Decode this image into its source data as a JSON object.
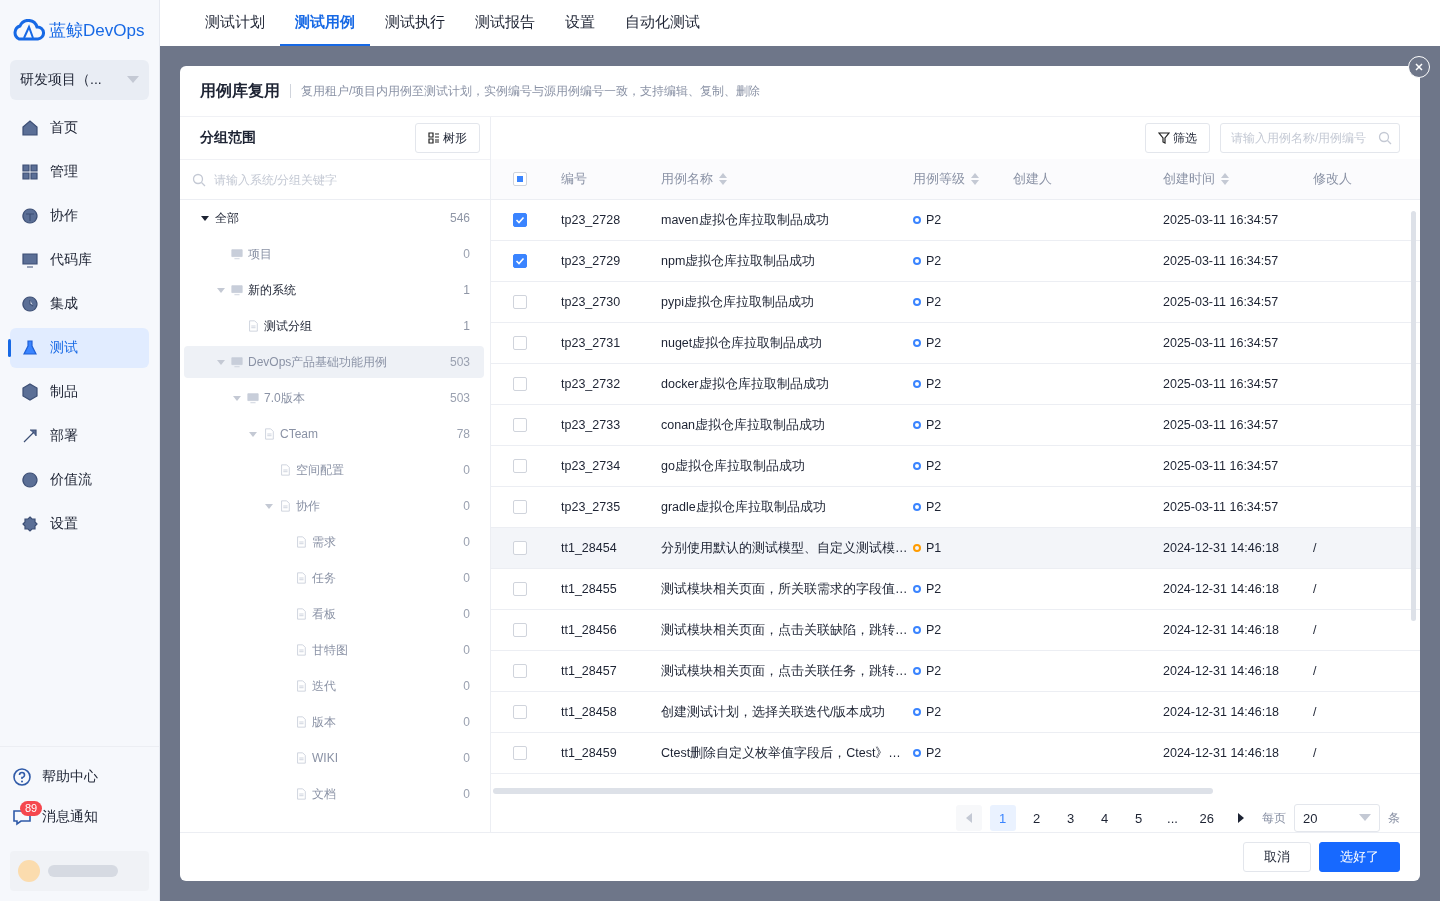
{
  "brand": {
    "name": "蓝鲸DevOps"
  },
  "project_select": {
    "value": "研发项目（..."
  },
  "top_tabs": [
    {
      "label": "测试计划",
      "selected": false
    },
    {
      "label": "测试用例",
      "selected": true
    },
    {
      "label": "测试执行",
      "selected": false
    },
    {
      "label": "测试报告",
      "selected": false
    },
    {
      "label": "设置",
      "selected": false
    },
    {
      "label": "自动化测试",
      "selected": false
    }
  ],
  "nav": [
    {
      "label": "首页",
      "selected": false
    },
    {
      "label": "管理",
      "selected": false
    },
    {
      "label": "协作",
      "selected": false
    },
    {
      "label": "代码库",
      "selected": false
    },
    {
      "label": "集成",
      "selected": false
    },
    {
      "label": "测试",
      "selected": true
    },
    {
      "label": "制品",
      "selected": false
    },
    {
      "label": "部署",
      "selected": false
    },
    {
      "label": "价值流",
      "selected": false
    },
    {
      "label": "设置",
      "selected": false
    }
  ],
  "nav_bottom": [
    {
      "kind": "help",
      "label": "帮助中心"
    },
    {
      "kind": "message",
      "label": "消息通知",
      "badge": "89"
    }
  ],
  "dialog": {
    "title": "用例库复用",
    "subtitle": "复用租户/项目内用例至测试计划，实例编号与源用例编号一致，支持编辑、复制、删除",
    "group_panel": {
      "title": "分组范围",
      "view_button": "树形",
      "search": {
        "placeholder": "请输入系统/分组关键字"
      },
      "tree": [
        {
          "label": "全部",
          "count": "546",
          "expanded": true,
          "disabled": false,
          "selected": false,
          "children": [
            {
              "label": "项目",
              "count": "0",
              "kind": "system",
              "disabled": true,
              "selected": false
            },
            {
              "label": "新的系统",
              "count": "1",
              "kind": "system",
              "expanded": true,
              "disabled": false,
              "selected": false,
              "children": [
                {
                  "label": "测试分组",
                  "count": "1",
                  "kind": "group",
                  "disabled": false,
                  "selected": false
                }
              ]
            },
            {
              "label": "DevOps产品基础功能用例",
              "count": "503",
              "kind": "system",
              "expanded": true,
              "disabled": true,
              "selected": true,
              "children": [
                {
                  "label": "7.0版本",
                  "count": "503",
                  "kind": "system",
                  "expanded": true,
                  "disabled": true,
                  "selected": false,
                  "children": [
                    {
                      "label": "CTeam",
                      "count": "78",
                      "kind": "group",
                      "expanded": true,
                      "disabled": true,
                      "selected": false,
                      "children": [
                        {
                          "label": "空间配置",
                          "count": "0",
                          "kind": "group",
                          "disabled": true,
                          "selected": false
                        },
                        {
                          "label": "协作",
                          "count": "0",
                          "kind": "group",
                          "expanded": true,
                          "disabled": true,
                          "selected": false,
                          "children": [
                            {
                              "label": "需求",
                              "count": "0",
                              "kind": "group",
                              "disabled": true,
                              "selected": false
                            },
                            {
                              "label": "任务",
                              "count": "0",
                              "kind": "group",
                              "disabled": true,
                              "selected": false
                            },
                            {
                              "label": "看板",
                              "count": "0",
                              "kind": "group",
                              "disabled": true,
                              "selected": false
                            },
                            {
                              "label": "甘特图",
                              "count": "0",
                              "kind": "group",
                              "disabled": true,
                              "selected": false
                            },
                            {
                              "label": "迭代",
                              "count": "0",
                              "kind": "group",
                              "disabled": true,
                              "selected": false
                            },
                            {
                              "label": "版本",
                              "count": "0",
                              "kind": "group",
                              "disabled": true,
                              "selected": false
                            },
                            {
                              "label": "WIKI",
                              "count": "0",
                              "kind": "group",
                              "disabled": true,
                              "selected": false
                            },
                            {
                              "label": "文档",
                              "count": "0",
                              "kind": "group",
                              "disabled": true,
                              "selected": false
                            }
                          ]
                        }
                      ]
                    }
                  ]
                }
              ]
            }
          ]
        }
      ]
    },
    "case_panel": {
      "filter_button": "筛选",
      "search": {
        "placeholder": "请输入用例名称/用例编号"
      },
      "header_checkbox": {
        "indeterminate": true
      },
      "columns": [
        {
          "label": "编号",
          "sortable": false
        },
        {
          "label": "用例名称",
          "sortable": true
        },
        {
          "label": "用例等级",
          "sortable": true
        },
        {
          "label": "创建人",
          "sortable": false
        },
        {
          "label": "创建时间",
          "sortable": true
        },
        {
          "label": "修改人",
          "sortable": false
        }
      ],
      "rows": [
        {
          "checked": true,
          "selected": false,
          "id": "tp23_2728",
          "name": "maven虚拟仓库拉取制品成功",
          "level": "P2",
          "color": "#3a84ff",
          "created": "2025-03-11 16:34:57"
        },
        {
          "checked": true,
          "selected": false,
          "id": "tp23_2729",
          "name": "npm虚拟仓库拉取制品成功",
          "level": "P2",
          "color": "#3a84ff",
          "created": "2025-03-11 16:34:57"
        },
        {
          "checked": false,
          "selected": false,
          "id": "tp23_2730",
          "name": "pypi虚拟仓库拉取制品成功",
          "level": "P2",
          "color": "#3a84ff",
          "created": "2025-03-11 16:34:57"
        },
        {
          "checked": false,
          "selected": false,
          "id": "tp23_2731",
          "name": "nuget虚拟仓库拉取制品成功",
          "level": "P2",
          "color": "#3a84ff",
          "created": "2025-03-11 16:34:57"
        },
        {
          "checked": false,
          "selected": false,
          "id": "tp23_2732",
          "name": "docker虚拟仓库拉取制品成功",
          "level": "P2",
          "color": "#3a84ff",
          "created": "2025-03-11 16:34:57"
        },
        {
          "checked": false,
          "selected": false,
          "id": "tp23_2733",
          "name": "conan虚拟仓库拉取制品成功",
          "level": "P2",
          "color": "#3a84ff",
          "created": "2025-03-11 16:34:57"
        },
        {
          "checked": false,
          "selected": false,
          "id": "tp23_2734",
          "name": "go虚拟仓库拉取制品成功",
          "level": "P2",
          "color": "#3a84ff",
          "created": "2025-03-11 16:34:57"
        },
        {
          "checked": false,
          "selected": false,
          "id": "tp23_2735",
          "name": "gradle虚拟仓库拉取制品成功",
          "level": "P2",
          "color": "#3a84ff",
          "created": "2025-03-11 16:34:57"
        },
        {
          "checked": false,
          "selected": true,
          "id": "tt1_28454",
          "name": "分别使用默认的测试模型、自定义测试模…",
          "level": "P1",
          "color": "#ff9c01",
          "created": "2024-12-31 14:46:18",
          "modifier": "/"
        },
        {
          "checked": false,
          "selected": false,
          "id": "tt1_28455",
          "name": "测试模块相关页面，所关联需求的字段值…",
          "level": "P2",
          "color": "#3a84ff",
          "created": "2024-12-31 14:46:18",
          "modifier": "/"
        },
        {
          "checked": false,
          "selected": false,
          "id": "tt1_28456",
          "name": "测试模块相关页面，点击关联缺陷，跳转…",
          "level": "P2",
          "color": "#3a84ff",
          "created": "2024-12-31 14:46:18",
          "modifier": "/"
        },
        {
          "checked": false,
          "selected": false,
          "id": "tt1_28457",
          "name": "测试模块相关页面，点击关联任务，跳转…",
          "level": "P2",
          "color": "#3a84ff",
          "created": "2024-12-31 14:46:18",
          "modifier": "/"
        },
        {
          "checked": false,
          "selected": false,
          "id": "tt1_28458",
          "name": "创建测试计划，选择关联迭代/版本成功",
          "level": "P2",
          "color": "#3a84ff",
          "created": "2024-12-31 14:46:18",
          "modifier": "/"
        },
        {
          "checked": false,
          "selected": false,
          "id": "tt1_28459",
          "name": "Ctest删除自定义枚举值字段后，Ctest》…",
          "level": "P2",
          "color": "#3a84ff",
          "created": "2024-12-31 14:46:18",
          "modifier": "/"
        }
      ],
      "pagination": {
        "prev_disabled": true,
        "pages": [
          {
            "label": "1",
            "selected": true
          },
          {
            "label": "2",
            "selected": false
          },
          {
            "label": "3",
            "selected": false
          },
          {
            "label": "4",
            "selected": false
          },
          {
            "label": "5",
            "selected": false
          },
          {
            "label": "...",
            "selected": false
          },
          {
            "label": "26",
            "selected": false
          }
        ],
        "per_page_label": "每页",
        "per_page": "20",
        "per_page_unit": "条"
      }
    },
    "buttons": [
      {
        "kind": "secondary",
        "label": "取消"
      },
      {
        "kind": "primary",
        "label": "选好了"
      }
    ]
  }
}
